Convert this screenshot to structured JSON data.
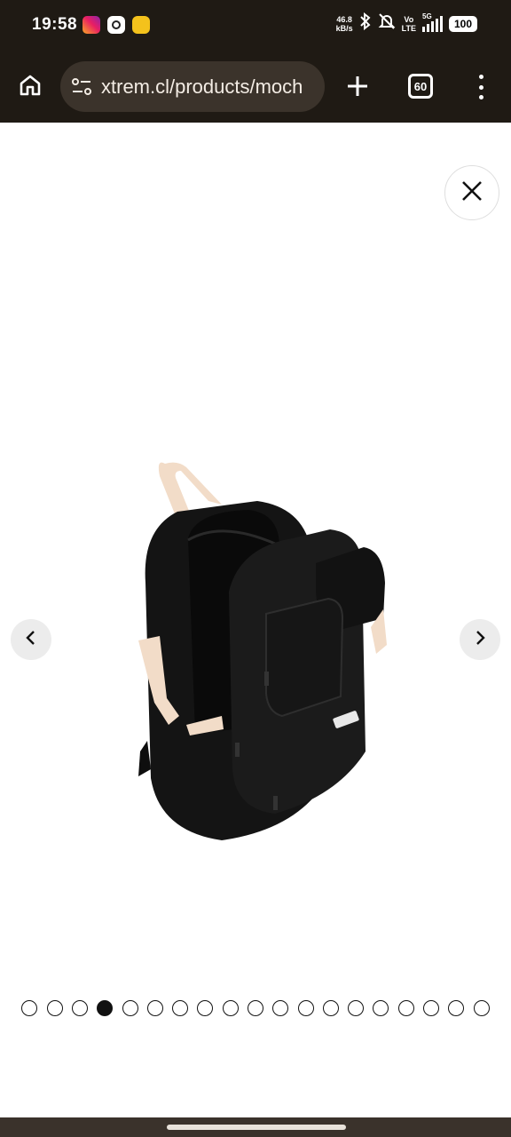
{
  "status_bar": {
    "time": "19:58",
    "notification_icons": [
      "instagram-icon",
      "chatgpt-icon",
      "app-icon"
    ],
    "net_speed_value": "46.8",
    "net_speed_unit": "kB/s",
    "volte_top": "Vo",
    "volte_bottom": "LTE",
    "network_type": "5G",
    "battery": "100"
  },
  "browser": {
    "url": "xtrem.cl/products/moch",
    "tab_count": "60",
    "icons": [
      "home-icon",
      "site-settings-icon",
      "new-tab-icon",
      "tab-switcher-icon",
      "more-menu-icon"
    ]
  },
  "gallery": {
    "image_description_icon": "backpack-product-image",
    "total_images": 19,
    "active_index": 4,
    "accent_color": "#111111"
  }
}
